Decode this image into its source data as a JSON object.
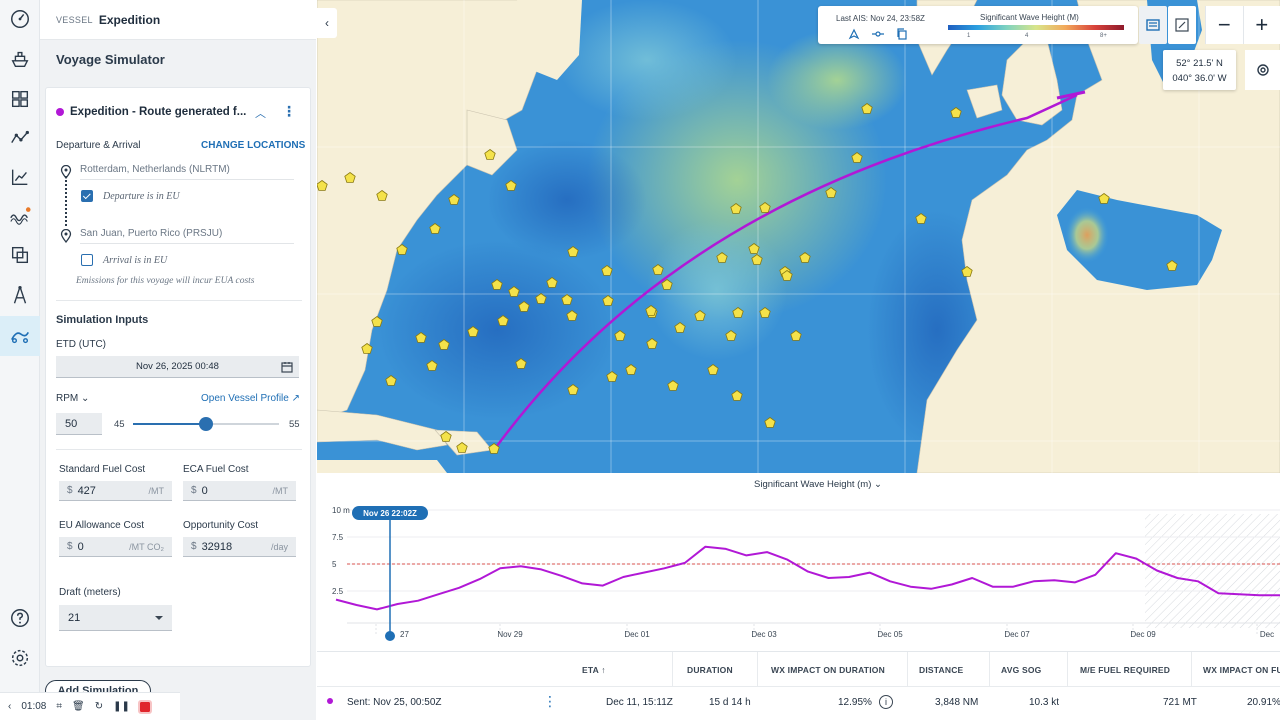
{
  "header": {
    "vessel_label": "VESSEL",
    "vessel_name": "Expedition"
  },
  "panel": {
    "title": "Voyage Simulator",
    "route": {
      "name": "Expedition - Route generated f...",
      "color": "#b118d6"
    },
    "departure_arrival": {
      "label": "Departure & Arrival",
      "change_locations": "CHANGE LOCATIONS",
      "departure": "Rotterdam, Netherlands (NLRTM)",
      "departure_eu_label": "Departure is in EU",
      "departure_eu_checked": true,
      "arrival": "San Juan, Puerto Rico (PRSJU)",
      "arrival_eu_label": "Arrival is in EU",
      "arrival_eu_checked": false,
      "emissions_note": "Emissions for this voyage will incur EUA costs"
    },
    "inputs": {
      "title": "Simulation Inputs",
      "etd_label": "ETD (UTC)",
      "etd_value": "Nov 26, 2025 00:48",
      "rpm_label": "RPM",
      "vessel_profile_link": "Open Vessel Profile",
      "rpm_value": "50",
      "rpm_min": "45",
      "rpm_max": "55",
      "rpm_fraction": 0.5,
      "standard_fuel": {
        "label": "Standard Fuel Cost",
        "currency": "$",
        "value": "427",
        "unit": "/MT"
      },
      "eca_fuel": {
        "label": "ECA Fuel Cost",
        "currency": "$",
        "value": "0",
        "unit": "/MT"
      },
      "eu_allowance": {
        "label": "EU Allowance Cost",
        "currency": "$",
        "value": "0",
        "unit": "/MT CO₂"
      },
      "opportunity": {
        "label": "Opportunity Cost",
        "currency": "$",
        "value": "32918",
        "unit": "/day"
      },
      "draft_label": "Draft (meters)",
      "draft_value": "21"
    },
    "add_simulation": "Add Simulation"
  },
  "player": {
    "time": "01:08"
  },
  "map": {
    "last_ais": "Last AIS: Nov 24, 23:58Z",
    "legend_title": "Significant Wave Height (M)",
    "legend_ticks": [
      "1",
      "4",
      "8+"
    ],
    "coord_lat": "52° 21.5' N",
    "coord_lon": "040° 36.0' W"
  },
  "chart_data": {
    "type": "line",
    "title": "Significant Wave Height (m)",
    "marker_label": "Nov 26 22:02Z",
    "threshold": 5,
    "ylim": [
      0,
      10
    ],
    "y_ticks": [
      "10 m",
      "7.5",
      "5",
      "2.5"
    ],
    "x_ticks": [
      "27",
      "Nov 29",
      "Dec 01",
      "Dec 03",
      "Dec 05",
      "Dec 07",
      "Dec 09",
      "Dec"
    ],
    "series": [
      {
        "values": [
          1.7,
          1.2,
          0.8,
          1.3,
          1.6,
          2.2,
          2.8,
          3.6,
          4.6,
          4.8,
          4.5,
          3.9,
          3.2,
          3.0,
          3.8,
          4.2,
          4.6,
          5.1,
          6.6,
          6.4,
          5.8,
          6.1,
          5.4,
          4.3,
          3.7,
          3.8,
          4.2,
          3.4,
          2.9,
          2.7,
          3.1,
          3.7,
          2.9,
          2.9,
          3.4,
          3.5,
          3.3,
          4.0,
          6.0,
          5.5,
          4.4,
          3.7,
          3.4,
          2.3,
          2.2,
          2.1,
          2.1
        ]
      }
    ]
  },
  "table": {
    "columns": [
      "ETA",
      "DURATION",
      "WX IMPACT ON DURATION",
      "DISTANCE",
      "AVG SOG",
      "M/E FUEL REQUIRED",
      "WX IMPACT ON FUE"
    ],
    "row": {
      "name": "Sent: Nov 25, 00:50Z",
      "eta": "Dec 11, 15:11Z",
      "duration": "15 d 14 h",
      "wx_duration": "12.95%",
      "distance": "3,848 NM",
      "avg_sog": "10.3 kt",
      "fuel": "721 MT",
      "wx_fuel": "20.91%"
    }
  }
}
